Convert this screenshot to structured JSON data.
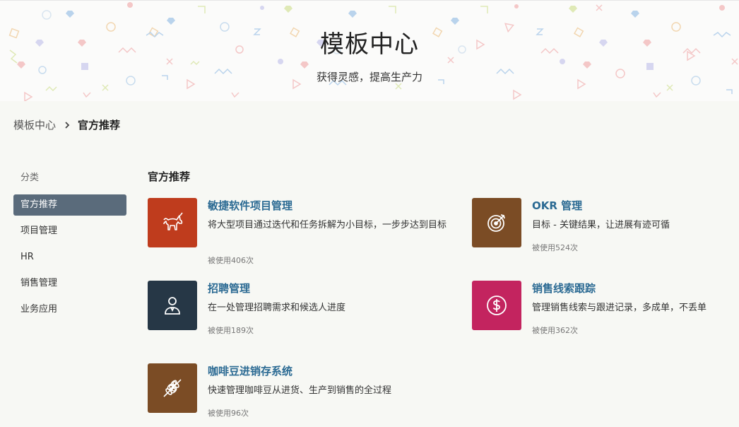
{
  "hero": {
    "title": "模板中心",
    "subtitle": "获得灵感，提高生产力"
  },
  "breadcrumb": {
    "home": "模板中心",
    "current": "官方推荐"
  },
  "sidebar": {
    "heading": "分类",
    "items": [
      {
        "label": "官方推荐",
        "active": true
      },
      {
        "label": "项目管理",
        "active": false
      },
      {
        "label": "HR",
        "active": false
      },
      {
        "label": "销售管理",
        "active": false
      },
      {
        "label": "业务应用",
        "active": false
      }
    ]
  },
  "main": {
    "section_title": "官方推荐",
    "templates": [
      {
        "title": "敏捷软件项目管理",
        "desc": "将大型项目通过迭代和任务拆解为小目标，一步步达到目标",
        "used": "被使用406次",
        "icon": "unicorn-icon",
        "color": "#bf3c1d"
      },
      {
        "title": "OKR 管理",
        "desc": "目标 - 关键结果，让进展有迹可循",
        "used": "被使用524次",
        "icon": "target-icon",
        "color": "#7b4c25"
      },
      {
        "title": "招聘管理",
        "desc": "在一处管理招聘需求和候选人进度",
        "used": "被使用189次",
        "icon": "person-icon",
        "color": "#263746"
      },
      {
        "title": "销售线索跟踪",
        "desc": "管理销售线索与跟进记录，多成单，不丢单",
        "used": "被使用362次",
        "icon": "dollar-icon",
        "color": "#c3245f"
      },
      {
        "title": "咖啡豆进销存系统",
        "desc": "快速管理咖啡豆从进货、生产到销售的全过程",
        "used": "被使用96次",
        "icon": "wheat-icon",
        "color": "#7b4c25"
      }
    ]
  }
}
